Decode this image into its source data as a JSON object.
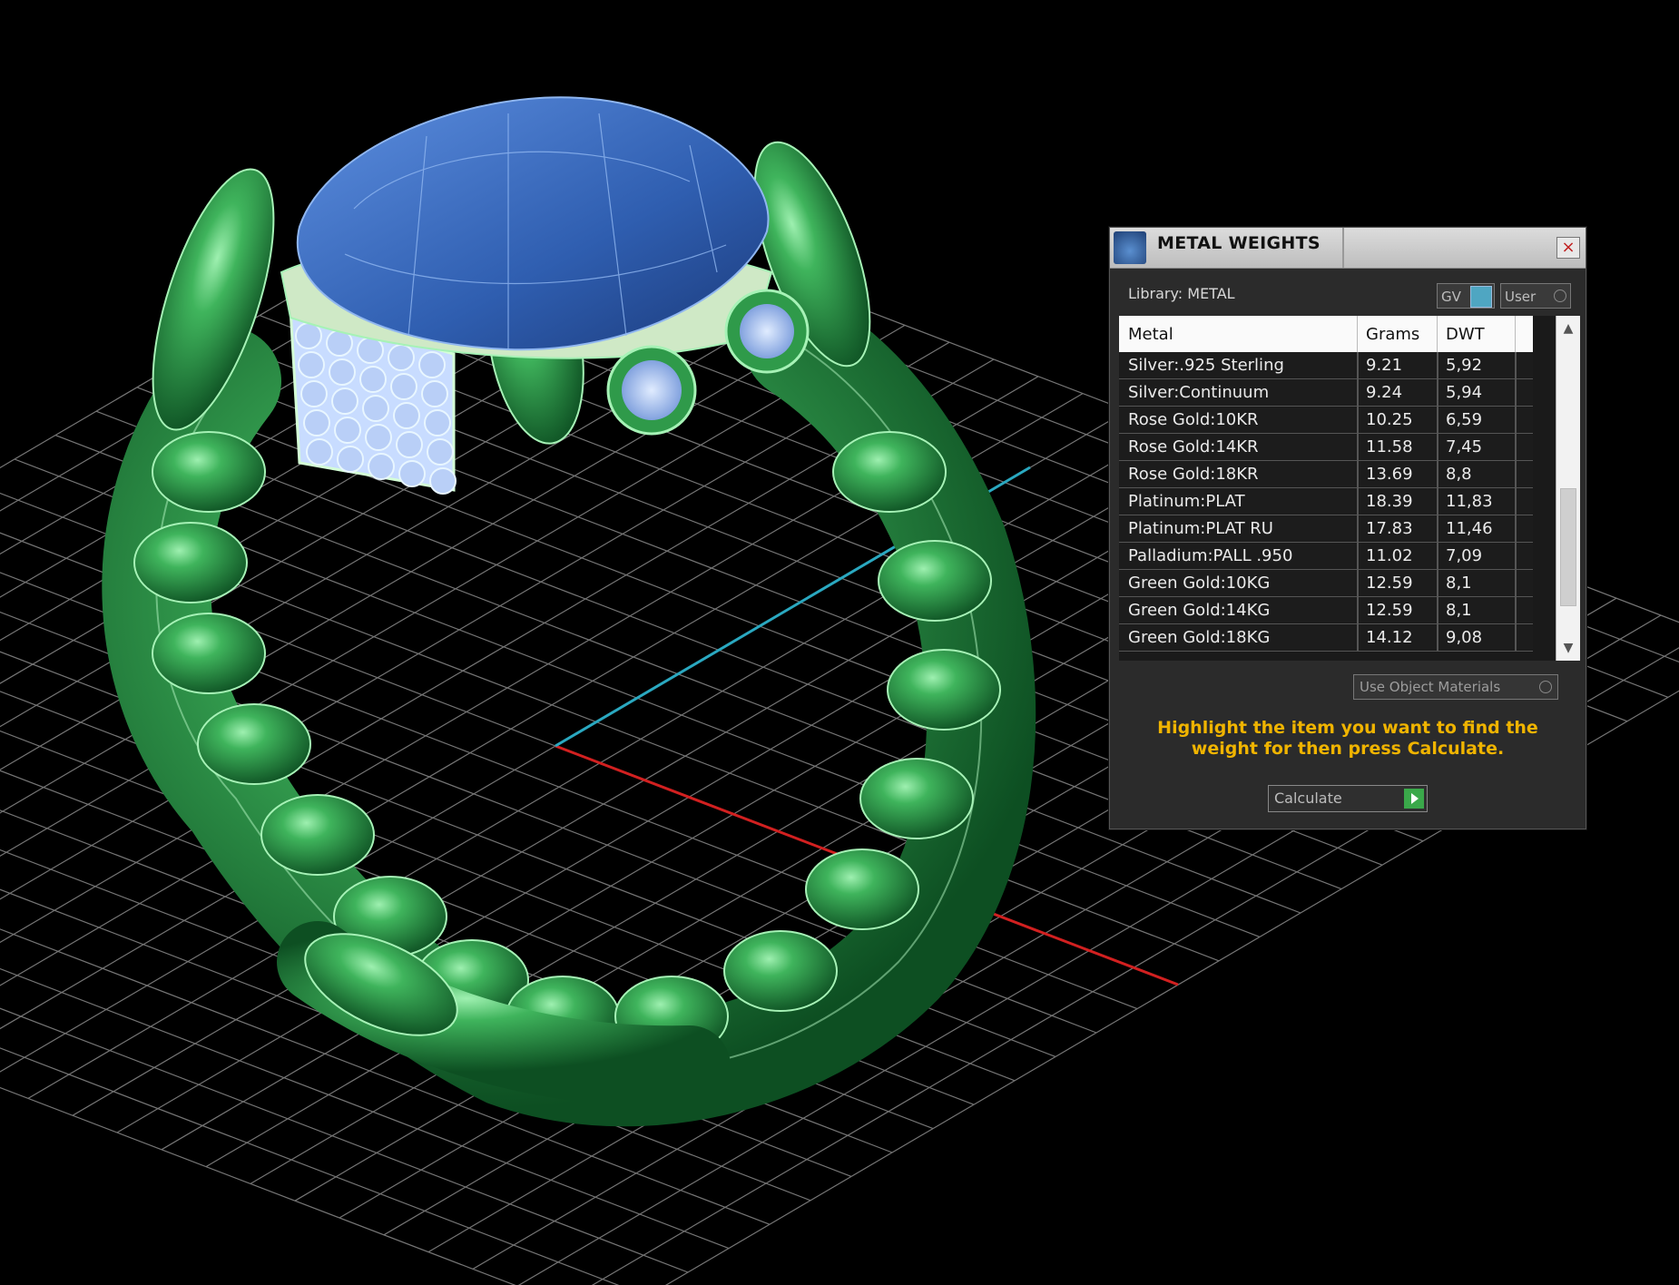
{
  "panel": {
    "title": "METAL WEIGHTS",
    "close_label": "×",
    "library_label": "Library: METAL",
    "gv_label": "GV",
    "user_label": "User",
    "table": {
      "headers": [
        "Metal",
        "Grams",
        "DWT"
      ],
      "rows": [
        [
          "Silver:.925 Sterling",
          "9.21",
          "5,92"
        ],
        [
          "Silver:Continuum",
          "9.24",
          "5,94"
        ],
        [
          "Rose Gold:10KR",
          "10.25",
          "6,59"
        ],
        [
          "Rose Gold:14KR",
          "11.58",
          "7,45"
        ],
        [
          "Rose Gold:18KR",
          "13.69",
          "8,8"
        ],
        [
          "Platinum:PLAT",
          "18.39",
          "11,83"
        ],
        [
          "Platinum:PLAT RU",
          "17.83",
          "11,46"
        ],
        [
          "Palladium:PALL .950",
          "11.02",
          "7,09"
        ],
        [
          "Green Gold:10KG",
          "12.59",
          "8,1"
        ],
        [
          "Green Gold:14KG",
          "12.59",
          "8,1"
        ],
        [
          "Green Gold:18KG",
          "14.12",
          "9,08"
        ]
      ],
      "scroll_up": "▲",
      "scroll_down": "▼"
    },
    "use_object_materials_label": "Use Object Materials",
    "instruction": "Highlight the item you want to find the weight for then press Calculate.",
    "calculate_label": "Calculate"
  },
  "colors": {
    "ring_green": "#2f9a4a",
    "gem_blue": "#3d6fbf",
    "grid": "#8a8a8a",
    "axis_x": "#d22020",
    "axis_y": "#2aa8c0",
    "instruction_text": "#f0b400"
  },
  "icons": [
    "app-logo-icon",
    "close-icon",
    "scroll-up-icon",
    "scroll-down-icon",
    "play-icon",
    "radio-icon"
  ]
}
